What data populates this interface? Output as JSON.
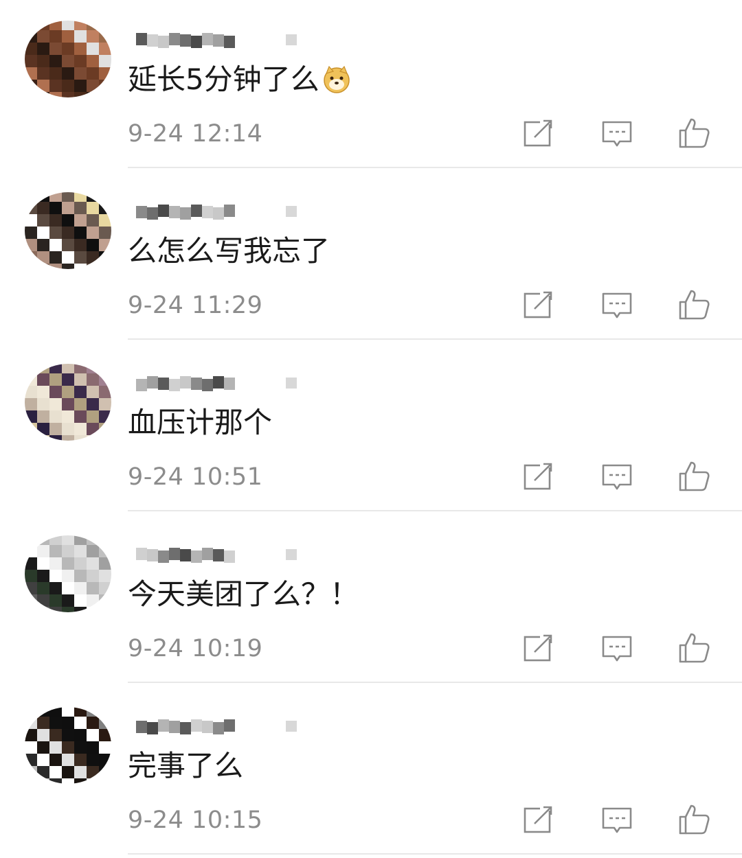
{
  "comments": [
    {
      "text": "延长5分钟了么",
      "emoji": "doge-emoji",
      "timestamp": "9-24 12:14",
      "avatar_colors": [
        "#7b4a33",
        "#3a1f14",
        "#a0603f",
        "#5a3322",
        "#c08060",
        "#2a1a12",
        "#8d5a3c",
        "#6b3b24",
        "#b07050",
        "#e0e0e0",
        "#4a2a1a",
        "#9a6a4a"
      ]
    },
    {
      "text": "么怎么写我忘了",
      "emoji": "",
      "timestamp": "9-24 11:29",
      "avatar_colors": [
        "#1a1a1a",
        "#3a2a22",
        "#8a6a5a",
        "#c0a090",
        "#2a2420",
        "#e8d8a0",
        "#5a4a40",
        "#9a8a7a",
        "#0f0f0f",
        "#b09080",
        "#6a5a50",
        "#ffffff"
      ]
    },
    {
      "text": "血压计那个",
      "emoji": "",
      "timestamp": "9-24 10:51",
      "avatar_colors": [
        "#e8e0d0",
        "#a08090",
        "#6a4a5a",
        "#d8c8a0",
        "#3a2a4a",
        "#c0b0a0",
        "#8a6a70",
        "#f0e8d8",
        "#5a3a5a",
        "#b0a080",
        "#2a2040",
        "#d0c0b0"
      ]
    },
    {
      "text": "今天美团了么？！",
      "emoji": "",
      "timestamp": "9-24 10:19",
      "avatar_colors": [
        "#e0e0e0",
        "#1a1a1a",
        "#c0c0c0",
        "#f0f0f0",
        "#606060",
        "#d0d0d0",
        "#2a3a2a",
        "#a0a0a0",
        "#ffffff",
        "#808080",
        "#b8b8b8",
        "#404040"
      ]
    },
    {
      "text": "完事了么",
      "emoji": "",
      "timestamp": "9-24 10:15",
      "avatar_colors": [
        "#2a2a2a",
        "#ffffff",
        "#1a1410",
        "#808080",
        "#3a2a20",
        "#c0c0c0",
        "#0f0f0f",
        "#ffffff",
        "#2a1a12",
        "#e0e0e0",
        "#404040",
        "#101010"
      ]
    }
  ],
  "icons": {
    "share": "share-icon",
    "reply": "reply-icon",
    "like": "thumbs-up-icon"
  },
  "colors": {
    "text": "#1a1a1a",
    "timestamp": "#8c8c8c",
    "icon": "#8a8a8a",
    "divider": "#e8e8e8"
  }
}
